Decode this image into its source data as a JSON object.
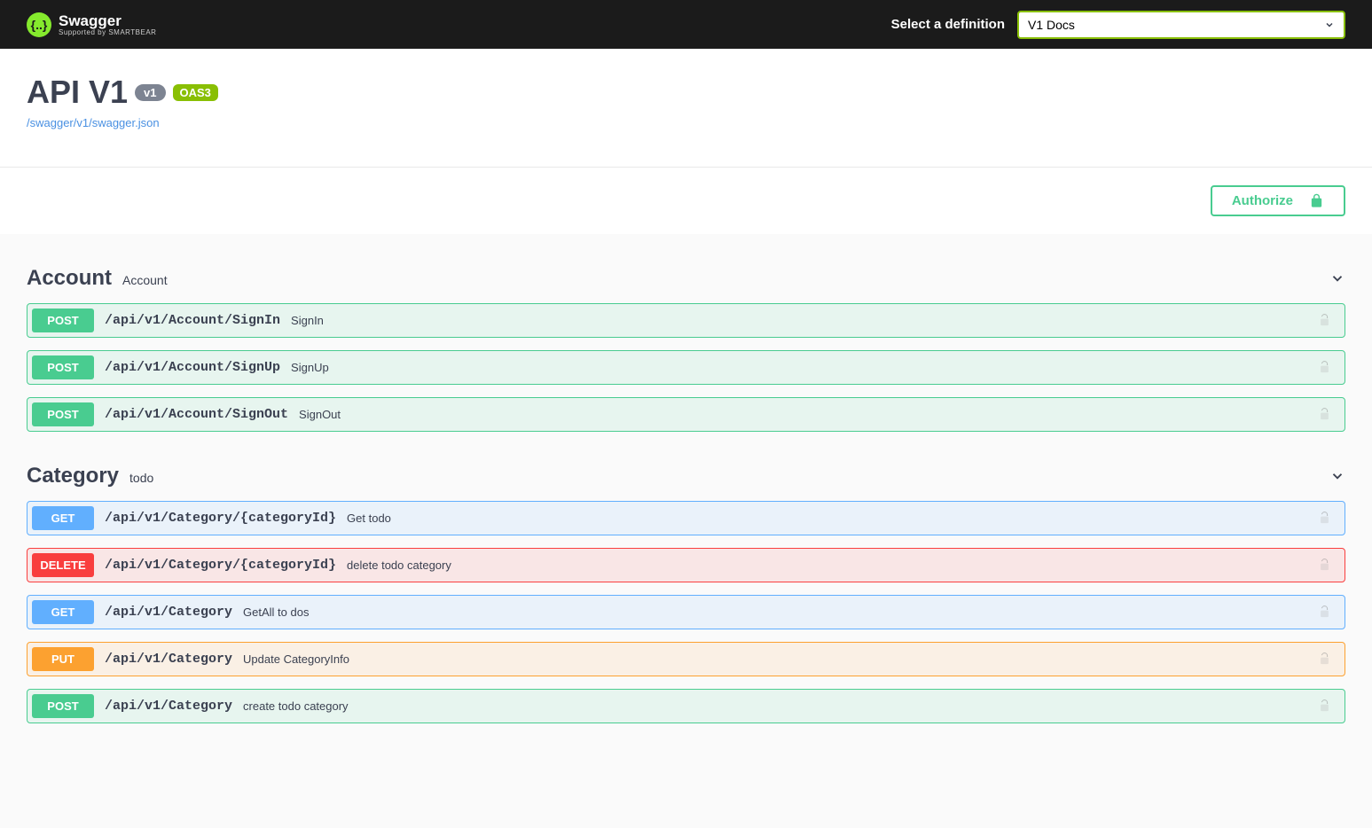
{
  "topbar": {
    "brand": "Swagger",
    "brand_sub": "Supported by SMARTBEAR",
    "select_label": "Select a definition",
    "selected_definition": "V1 Docs"
  },
  "info": {
    "title": "API V1",
    "version_badge": "v1",
    "oas_badge": "OAS3",
    "doc_url": "/swagger/v1/swagger.json"
  },
  "authorize_label": "Authorize",
  "tags": [
    {
      "name": "Account",
      "description": "Account",
      "operations": [
        {
          "method": "POST",
          "path": "/api/v1/Account/SignIn",
          "summary": "SignIn"
        },
        {
          "method": "POST",
          "path": "/api/v1/Account/SignUp",
          "summary": "SignUp"
        },
        {
          "method": "POST",
          "path": "/api/v1/Account/SignOut",
          "summary": "SignOut"
        }
      ]
    },
    {
      "name": "Category",
      "description": "todo",
      "operations": [
        {
          "method": "GET",
          "path": "/api/v1/Category/{categoryId}",
          "summary": "Get todo"
        },
        {
          "method": "DELETE",
          "path": "/api/v1/Category/{categoryId}",
          "summary": "delete todo category"
        },
        {
          "method": "GET",
          "path": "/api/v1/Category",
          "summary": "GetAll to dos"
        },
        {
          "method": "PUT",
          "path": "/api/v1/Category",
          "summary": "Update CategoryInfo"
        },
        {
          "method": "POST",
          "path": "/api/v1/Category",
          "summary": "create todo category"
        }
      ]
    }
  ]
}
